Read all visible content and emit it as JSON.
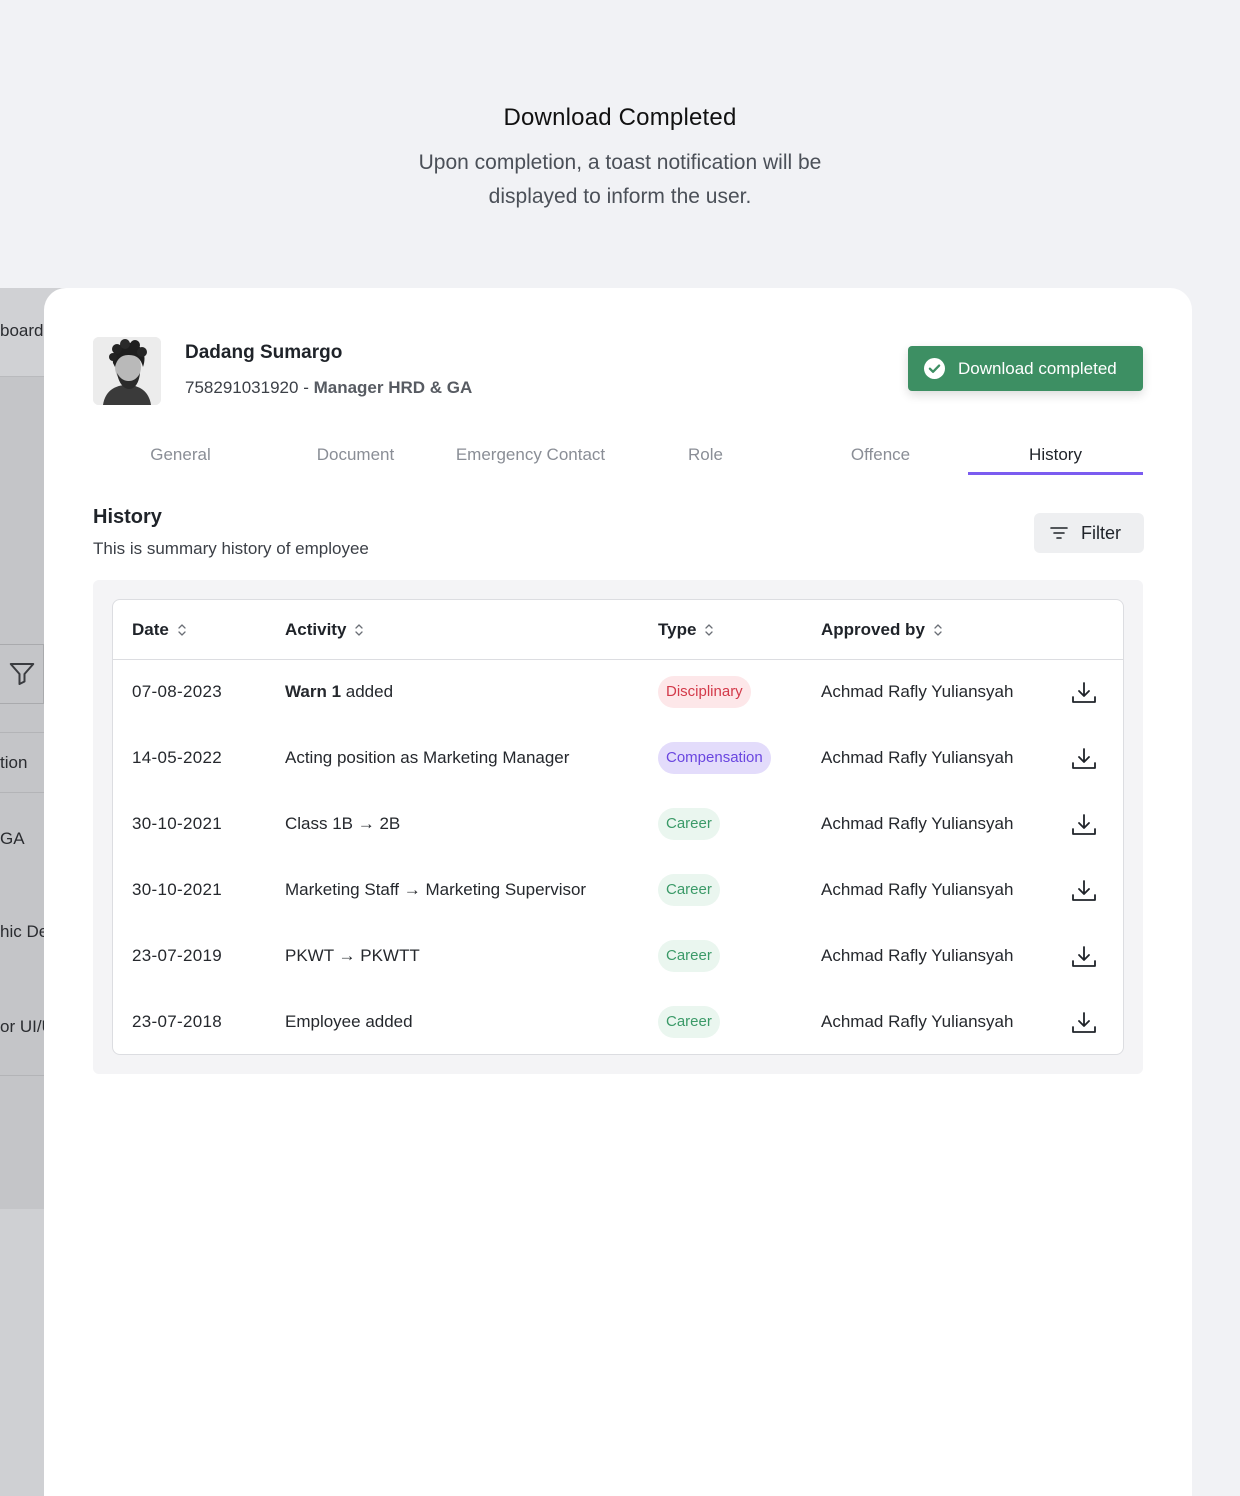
{
  "intro": {
    "title": "Download Completed",
    "description": "Upon completion, a toast notification will be displayed to inform the user."
  },
  "background": {
    "texts": [
      "boardi",
      "tion",
      "GA",
      "hic De",
      "or UI/U"
    ]
  },
  "employee": {
    "name": "Dadang Sumargo",
    "id": "758291031920",
    "separator": " - ",
    "role": "Manager HRD & GA"
  },
  "toast": {
    "message": "Download completed",
    "color": "#3d8f63",
    "icon": "check-circle-icon"
  },
  "tabs": [
    {
      "label": "General",
      "active": false
    },
    {
      "label": "Document",
      "active": false
    },
    {
      "label": "Emergency Contact",
      "active": false
    },
    {
      "label": "Role",
      "active": false
    },
    {
      "label": "Offence",
      "active": false
    },
    {
      "label": "History",
      "active": true
    }
  ],
  "accent_color": "#7b5cf0",
  "history": {
    "title": "History",
    "subtitle": "This is summary history of employee",
    "filter_label": "Filter",
    "columns": {
      "date": "Date",
      "activity": "Activity",
      "type": "Type",
      "approved_by": "Approved by"
    },
    "rows": [
      {
        "date": "07-08-2023",
        "activity_bold": "Warn 1",
        "activity": " added",
        "type": "Disciplinary",
        "type_key": "disciplinary",
        "approved_by": "Achmad Rafly Yuliansyah"
      },
      {
        "date": "14-05-2022",
        "activity_bold": "",
        "activity": "Acting position as Marketing Manager",
        "type": "Compensation",
        "type_key": "compensation",
        "approved_by": "Achmad Rafly Yuliansyah"
      },
      {
        "date": "30-10-2021",
        "activity_bold": "",
        "activity": "Class 1B → 2B",
        "type": "Career",
        "type_key": "career",
        "approved_by": "Achmad Rafly Yuliansyah"
      },
      {
        "date": "30-10-2021",
        "activity_bold": "",
        "activity": "Marketing Staff → Marketing Supervisor",
        "type": "Career",
        "type_key": "career",
        "approved_by": "Achmad Rafly Yuliansyah"
      },
      {
        "date": "23-07-2019",
        "activity_bold": "",
        "activity": "PKWT → PKWTT",
        "type": "Career",
        "type_key": "career",
        "approved_by": "Achmad Rafly Yuliansyah"
      },
      {
        "date": "23-07-2018",
        "activity_bold": "",
        "activity": "Employee added",
        "type": "Career",
        "type_key": "career",
        "approved_by": "Achmad Rafly Yuliansyah"
      }
    ]
  },
  "type_colors": {
    "disciplinary": "#d33a4a",
    "compensation": "#6a46e0",
    "career": "#3b9a68"
  }
}
